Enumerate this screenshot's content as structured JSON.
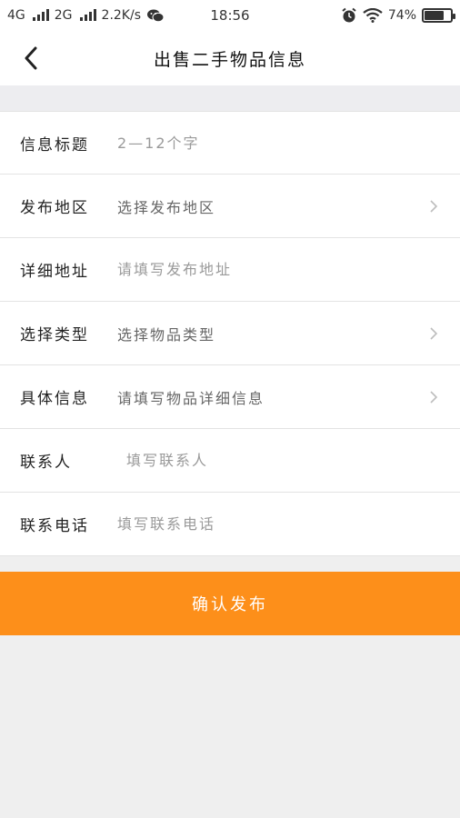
{
  "status_bar": {
    "net1": "4G",
    "net2": "2G",
    "speed": "2.2K/s",
    "time": "18:56",
    "battery_text": "74%",
    "battery_level": 74
  },
  "header": {
    "title": "出售二手物品信息"
  },
  "form": {
    "title_label": "信息标题",
    "title_placeholder": "2—12个字",
    "region_label": "发布地区",
    "region_value": "选择发布地区",
    "address_label": "详细地址",
    "address_placeholder": "请填写发布地址",
    "type_label": "选择类型",
    "type_value": "选择物品类型",
    "detail_label": "具体信息",
    "detail_value": "请填写物品详细信息",
    "contact_label": "联系人",
    "contact_placeholder": "填写联系人",
    "phone_label": "联系电话",
    "phone_placeholder": "填写联系电话"
  },
  "submit": {
    "label": "确认发布"
  },
  "colors": {
    "accent": "#fd8f1a",
    "background": "#efefef"
  }
}
